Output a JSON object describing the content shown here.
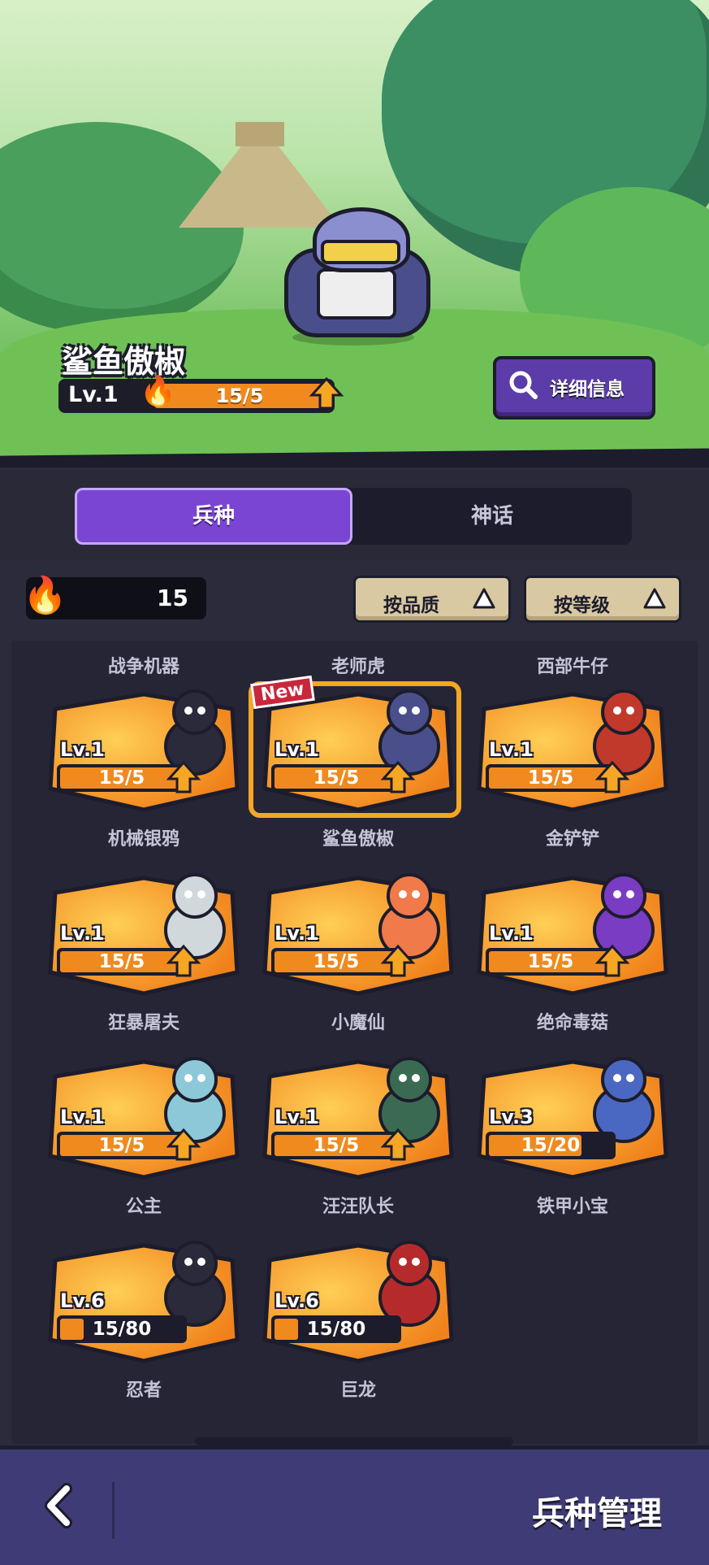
{
  "hero": {
    "name": "鲨鱼傲椒",
    "level": "Lv.1",
    "progress_text": "15/5",
    "detail_button": "详细信息"
  },
  "tabs": [
    {
      "label": "兵种",
      "active": true
    },
    {
      "label": "神话",
      "active": false
    }
  ],
  "resource": {
    "icon": "fire-icon",
    "value": "15"
  },
  "sort_buttons": [
    {
      "label": "按品质",
      "icon": "triangle-up-icon"
    },
    {
      "label": "按等级",
      "icon": "triangle-up-icon"
    }
  ],
  "top_names": [
    "战争机器",
    "老师虎",
    "西部牛仔"
  ],
  "cards": [
    {
      "name": "机械银鸦",
      "level": "Lv.1",
      "progress": "15/5",
      "fill": 1.0,
      "upgrade": true,
      "color": "#2b2a3a"
    },
    {
      "name": "鲨鱼傲椒",
      "level": "Lv.1",
      "progress": "15/5",
      "fill": 1.0,
      "upgrade": true,
      "badge": "New",
      "selected": true,
      "color": "#4a4f8c"
    },
    {
      "name": "金铲铲",
      "level": "Lv.1",
      "progress": "15/5",
      "fill": 1.0,
      "upgrade": true,
      "color": "#c0392b"
    },
    {
      "name": "狂暴屠夫",
      "level": "Lv.1",
      "progress": "15/5",
      "fill": 1.0,
      "upgrade": true,
      "color": "#d0d8dc"
    },
    {
      "name": "小魔仙",
      "level": "Lv.1",
      "progress": "15/5",
      "fill": 1.0,
      "upgrade": true,
      "color": "#f07a4a"
    },
    {
      "name": "绝命毒菇",
      "level": "Lv.1",
      "progress": "15/5",
      "fill": 1.0,
      "upgrade": true,
      "color": "#7a3cc2"
    },
    {
      "name": "公主",
      "level": "Lv.1",
      "progress": "15/5",
      "fill": 1.0,
      "upgrade": true,
      "color": "#8cc8d8"
    },
    {
      "name": "汪汪队长",
      "level": "Lv.1",
      "progress": "15/5",
      "fill": 1.0,
      "upgrade": true,
      "color": "#3b6a52"
    },
    {
      "name": "铁甲小宝",
      "level": "Lv.3",
      "progress": "15/20",
      "fill": 0.75,
      "upgrade": false,
      "color": "#4a68c2"
    },
    {
      "name": "忍者",
      "level": "Lv.6",
      "progress": "15/80",
      "fill": 0.19,
      "upgrade": false,
      "color": "#2b2a3a"
    },
    {
      "name": "巨龙",
      "level": "Lv.6",
      "progress": "15/80",
      "fill": 0.19,
      "upgrade": false,
      "color": "#b52b2b"
    }
  ],
  "bottom": {
    "title": "兵种管理",
    "back_icon": "chevron-left-icon"
  },
  "colors": {
    "accent": "#7a45d2",
    "card_orange": "#f08a1e",
    "upgrade_arrow": "#f5a623"
  }
}
